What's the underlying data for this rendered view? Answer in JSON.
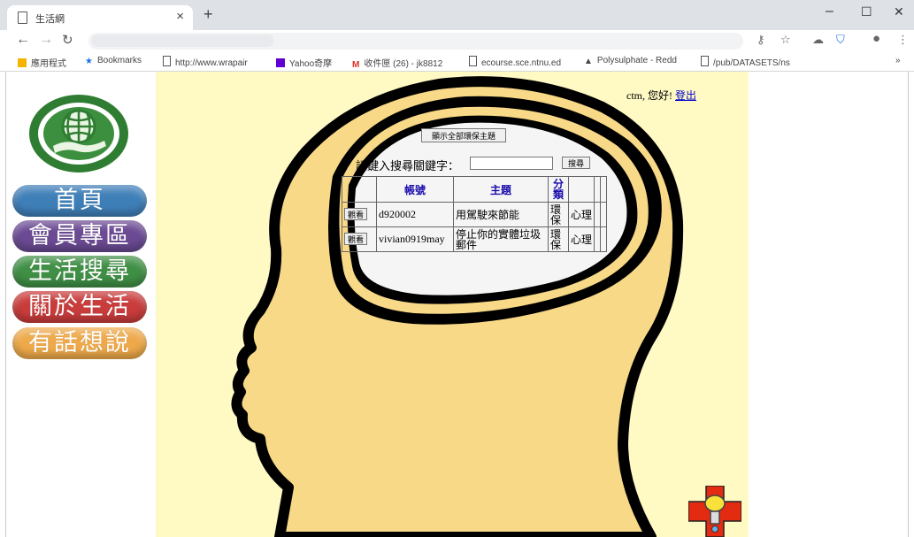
{
  "browser": {
    "tab_title": "生活網",
    "tab_close": "×",
    "new_tab": "+",
    "win_min": "–",
    "win_max": "☐",
    "win_close": "✕",
    "bookmarks": [
      {
        "label": "應用程式",
        "icon": "apps-icon"
      },
      {
        "label": "Bookmarks",
        "icon": "star-icon"
      },
      {
        "label": "http://www.wrapair",
        "icon": "page-icon"
      },
      {
        "label": "Yahoo奇摩",
        "icon": "yahoo-icon"
      },
      {
        "label": "收件匣 (26) - jk8812",
        "icon": "gmail-icon"
      },
      {
        "label": "ecourse.sce.ntnu.ed",
        "icon": "page-icon"
      },
      {
        "label": "Polysulphate - Redd",
        "icon": "triangle-icon"
      },
      {
        "label": "/pub/DATASETS/ns",
        "icon": "page-icon"
      }
    ],
    "more": "»"
  },
  "sidebar": {
    "items": [
      {
        "label": "首頁"
      },
      {
        "label": "會員專區"
      },
      {
        "label": "生活搜尋"
      },
      {
        "label": "關於生活"
      },
      {
        "label": "有話想說"
      }
    ]
  },
  "header": {
    "greeting": "ctm, 您好!",
    "logout": "登出"
  },
  "search": {
    "show_all_label": "顯示全部環保主題",
    "prompt": "請鍵入搜尋關鍵字：",
    "input_value": "",
    "button_label": "搜尋"
  },
  "table": {
    "headers": {
      "account": "帳號",
      "topic": "主題",
      "category": "分類"
    },
    "rows": [
      {
        "view": "觀看",
        "account": "d920002",
        "topic": "用駕駛來節能",
        "category": "環保",
        "tag": "心理"
      },
      {
        "view": "觀看",
        "account": "vivian0919may",
        "topic": "停止你的實體垃圾郵件",
        "category": "環保",
        "tag": "心理"
      }
    ]
  },
  "colors": {
    "content_bg": "#fff9c4",
    "head_fill": "#f8d987",
    "head_outline": "#000000",
    "link": "#0000cc"
  }
}
